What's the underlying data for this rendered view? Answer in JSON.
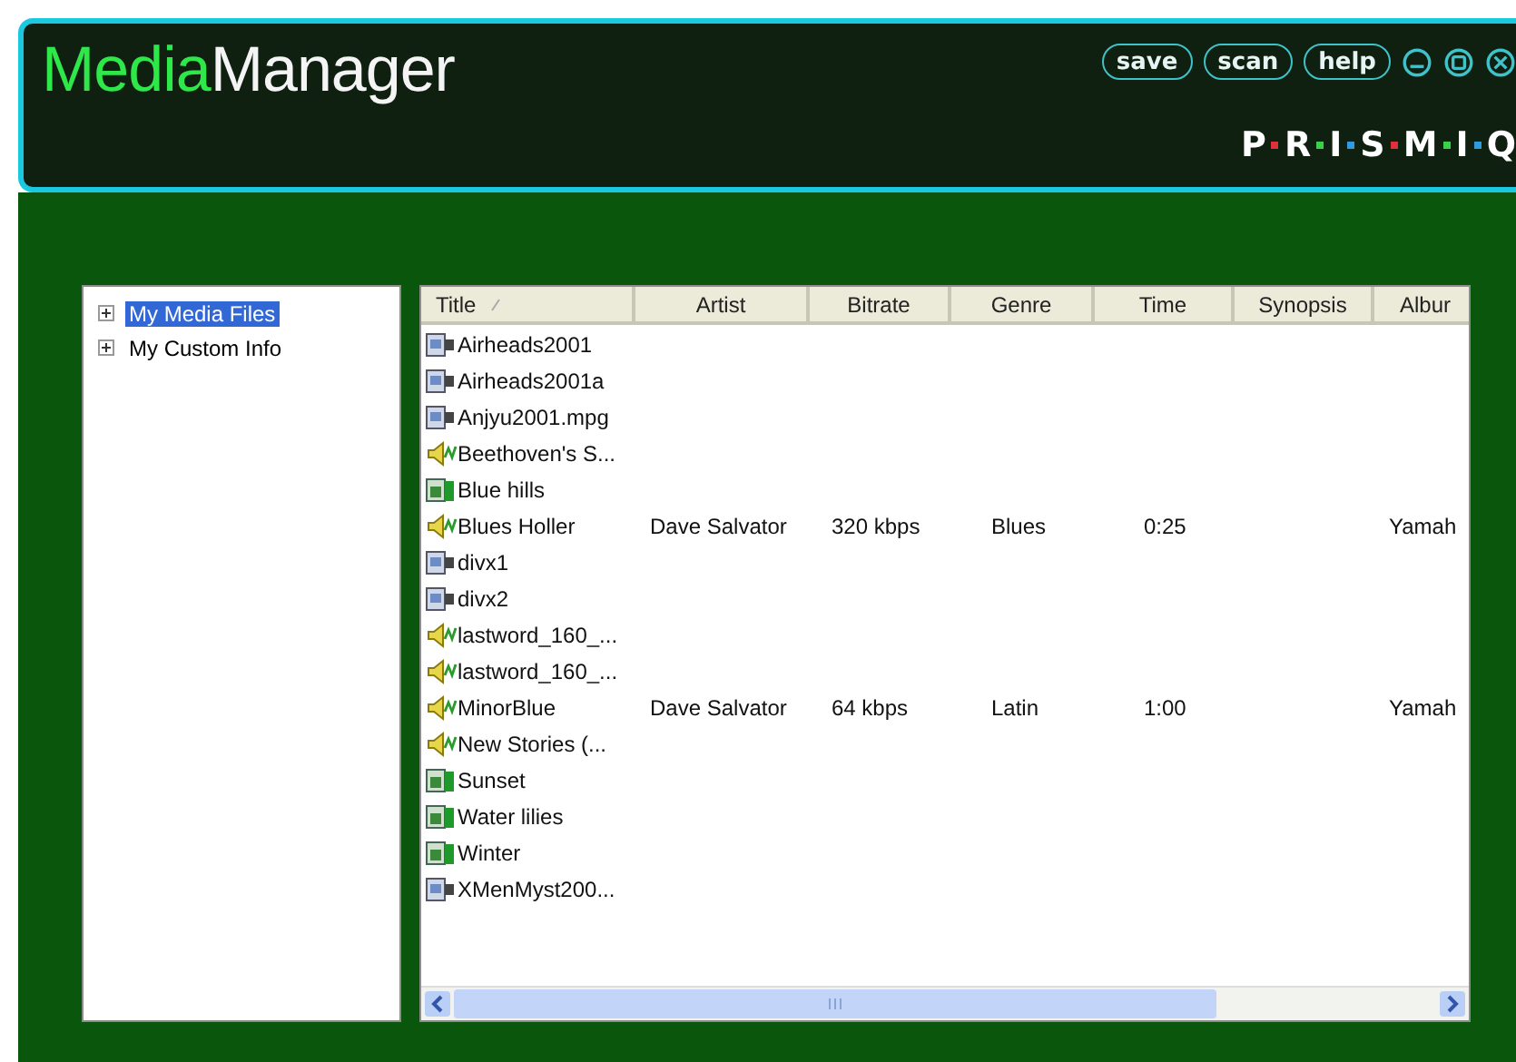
{
  "window": {
    "title_accent": "Media",
    "title_rest": "Manager",
    "buttons": [
      "save",
      "scan",
      "help"
    ],
    "brand": [
      "P",
      "R",
      "I",
      "S",
      "M",
      "I",
      "Q"
    ]
  },
  "tree": {
    "items": [
      {
        "label": "My Media Files",
        "selected": true,
        "expanded": false
      },
      {
        "label": "My Custom Info",
        "selected": false,
        "expanded": false
      }
    ]
  },
  "table": {
    "columns": [
      "Title",
      "Artist",
      "Bitrate",
      "Genre",
      "Time",
      "Synopsis",
      "Albur"
    ],
    "rows": [
      {
        "kind": "video",
        "cells": [
          "Airheads2001"
        ]
      },
      {
        "kind": "video",
        "cells": [
          "Airheads2001a"
        ]
      },
      {
        "kind": "video",
        "cells": [
          "Anjyu2001.mpg"
        ]
      },
      {
        "kind": "audio",
        "cells": [
          "Beethoven's S..."
        ]
      },
      {
        "kind": "image",
        "cells": [
          "Blue hills"
        ]
      },
      {
        "kind": "audio",
        "cells": [
          "Blues Holler",
          "Dave Salvator",
          "320 kbps",
          "Blues",
          "0:25",
          "",
          "Yamah"
        ]
      },
      {
        "kind": "video",
        "cells": [
          "divx1"
        ]
      },
      {
        "kind": "video",
        "cells": [
          "divx2"
        ]
      },
      {
        "kind": "audio",
        "cells": [
          "lastword_160_..."
        ]
      },
      {
        "kind": "audio",
        "cells": [
          "lastword_160_..."
        ]
      },
      {
        "kind": "audio",
        "cells": [
          "MinorBlue",
          "Dave Salvator",
          "64 kbps",
          "Latin",
          "1:00",
          "",
          "Yamah"
        ]
      },
      {
        "kind": "audio",
        "cells": [
          "New Stories (..."
        ]
      },
      {
        "kind": "image",
        "cells": [
          "Sunset"
        ]
      },
      {
        "kind": "image",
        "cells": [
          "Water lilies"
        ]
      },
      {
        "kind": "image",
        "cells": [
          "Winter"
        ]
      },
      {
        "kind": "video",
        "cells": [
          "XMenMyst200..."
        ]
      }
    ]
  }
}
